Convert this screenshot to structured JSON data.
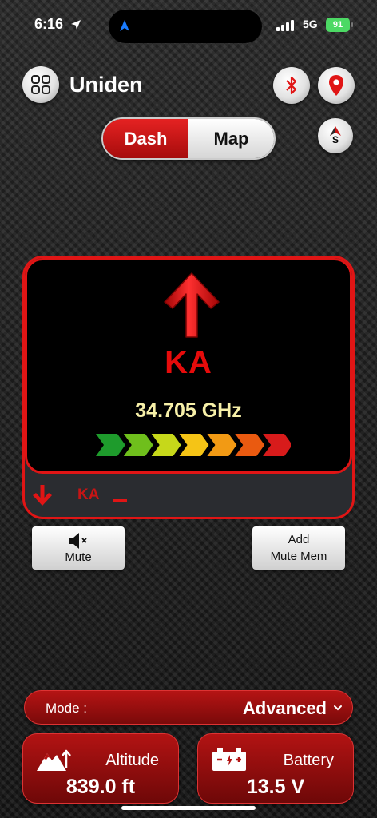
{
  "status_bar": {
    "time": "6:16",
    "network": "5G",
    "battery": "91"
  },
  "header": {
    "title": "Uniden",
    "compass_heading": "S"
  },
  "tabs": [
    {
      "label": "Dash",
      "active": true
    },
    {
      "label": "Map",
      "active": false
    }
  ],
  "alert": {
    "band": "KA",
    "frequency": "34.705 GHz",
    "strength_levels": 7,
    "strength_colors": [
      "#1e9b2c",
      "#6fbf1c",
      "#c6d81a",
      "#f5c416",
      "#f29a14",
      "#ea5a10",
      "#d81b1b"
    ],
    "history": [
      {
        "band": "KA"
      }
    ]
  },
  "actions": {
    "mute_label": "Mute",
    "add_mute_line1": "Add",
    "add_mute_line2": "Mute Mem"
  },
  "mode": {
    "label": "Mode :",
    "value": "Advanced"
  },
  "cards": {
    "altitude": {
      "label": "Altitude",
      "value": "839.0 ft"
    },
    "battery": {
      "label": "Battery",
      "value": "13.5 V"
    }
  },
  "colors": {
    "accent_red": "#e01515",
    "frequency_text": "#f7f0a8"
  }
}
